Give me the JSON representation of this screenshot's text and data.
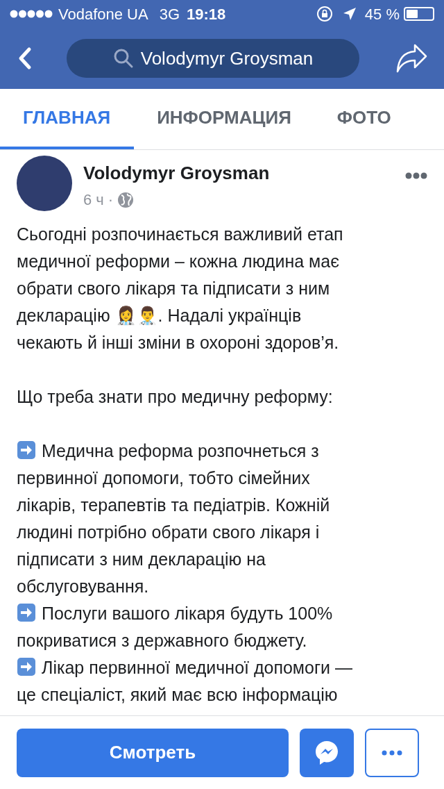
{
  "status_bar": {
    "carrier": "Vodafone UA",
    "network": "3G",
    "time": "19:18",
    "battery_percent": "45 %",
    "battery": {
      "level": 0.45
    }
  },
  "nav": {
    "search_value": "Volodymyr Groysman"
  },
  "tabs": [
    {
      "label": "ГЛАВНАЯ",
      "selected": true
    },
    {
      "label": "ИНФОРМАЦИЯ",
      "selected": false
    },
    {
      "label": "ФОТО",
      "selected": false
    }
  ],
  "post": {
    "author": "Volodymyr Groysman",
    "time": "6 ч",
    "separator": "·",
    "paragraphs": [
      {
        "kind": "text",
        "lines": [
          "Сьогодні розпочинається важливий етап",
          "медичної реформи – кожна людина має",
          "обрати свого лікаря та підписати з ним",
          "декларацію 👩‍⚕️👨‍⚕️. Надалі українців",
          "чекають й інші зміни в охороні здоров’я."
        ]
      },
      {
        "kind": "text",
        "lines": [
          "Що треба знати про медичну реформу:"
        ]
      },
      {
        "kind": "bullets",
        "items": [
          {
            "lines": [
              "Медична реформа розпочнеться з",
              "первинної допомоги, тобто сімейних",
              "лікарів, терапевтів та педіатрів. Кожній",
              "людині потрібно обрати свого лікаря і",
              "підписати з ним декларацію на",
              "обслуговування."
            ]
          },
          {
            "lines": [
              "Послуги вашого лікаря будуть 100%",
              "покриватися з державного бюджету."
            ]
          },
          {
            "lines": [
              "Лікар первинної медичної допомоги —",
              "це спеціаліст, який має всю інформацію"
            ]
          }
        ]
      }
    ]
  },
  "actions": {
    "primary": "Смотреть"
  }
}
